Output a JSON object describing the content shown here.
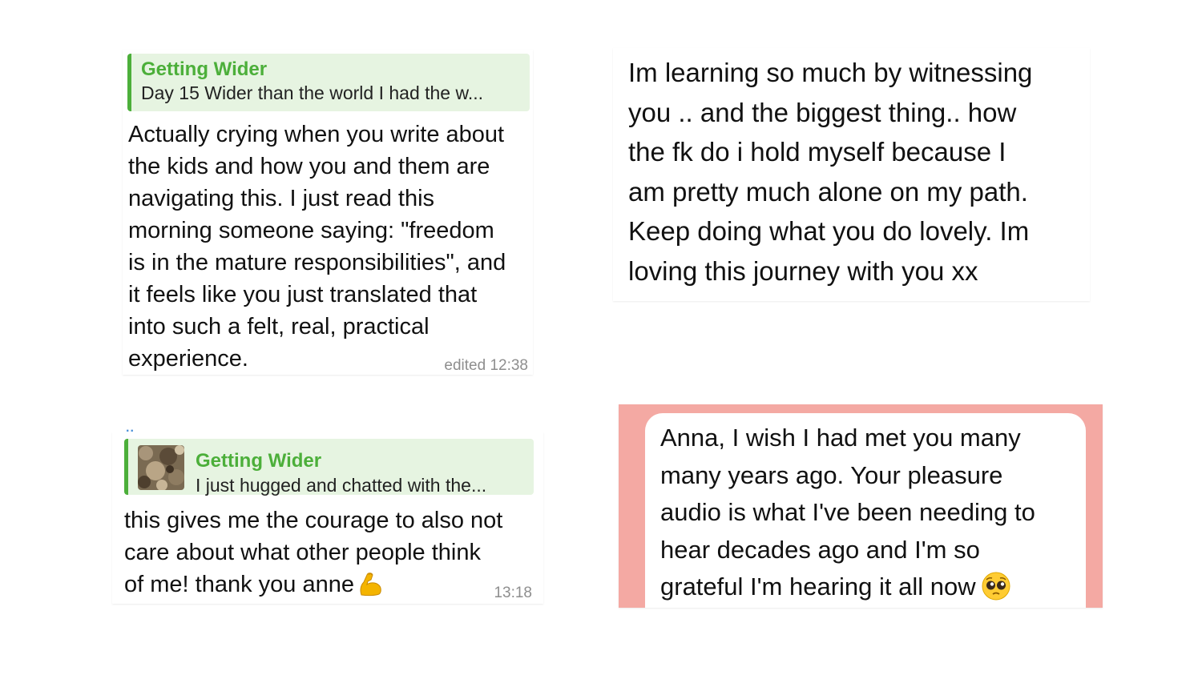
{
  "card1": {
    "reply_title": "Getting Wider",
    "reply_text": "Day 15 Wider than the world I had the w...",
    "lines": [
      "Actually crying when you write about",
      "the kids and how you and them are",
      "navigating this. I just read this",
      "morning someone saying: \"freedom",
      "is in the mature responsibilities\", and",
      "it feels like you just translated that",
      "into such a felt, real, practical",
      "experience."
    ],
    "time": "edited 12:38"
  },
  "card2": {
    "lines": [
      "Im learning so much by witnessing",
      "you .. and the biggest thing.. how",
      "the fk do i hold myself because I",
      "am pretty much alone on my path.",
      "Keep doing what you do lovely.  Im",
      "loving this journey with you xx"
    ]
  },
  "card3": {
    "top_marker": "..",
    "reply_title": "Getting Wider",
    "reply_text": "I just hugged and chatted with the...",
    "thumbnail_icon": "photo-thumbnail",
    "lines": [
      "this gives me the courage to also not",
      "care about what other people think",
      "of me! thank you anne"
    ],
    "emoji": "flexed-biceps-icon",
    "time": "13:18"
  },
  "card4": {
    "lines": [
      "Anna, I wish I had met you many",
      "many years ago. Your pleasure",
      "audio is what I've been needing to",
      "hear decades ago and I'm so",
      "grateful I'm hearing it all now"
    ],
    "emoji": "pleading-face-icon",
    "background_color": "#f4a9a3"
  },
  "colors": {
    "accent_green": "#4caf3a",
    "reply_bg": "#e6f4e1",
    "timestamp": "#8e8e8e"
  }
}
